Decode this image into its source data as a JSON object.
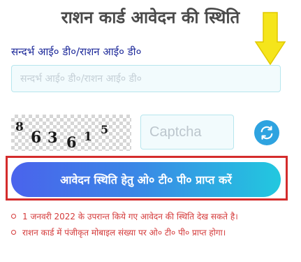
{
  "page": {
    "title": "राशन कार्ड आवेदन की स्थिति"
  },
  "reference": {
    "label": "सन्दर्भ आई० डी०/राशन आई० डी०",
    "value": "",
    "placeholder": "सन्दर्भ आई० डी०/राशन आई० डी०"
  },
  "captcha": {
    "chars": [
      "8",
      "6",
      "3",
      "6",
      "1",
      "5"
    ],
    "input_value": "",
    "input_placeholder": "Captcha",
    "refresh_icon": "refresh-icon"
  },
  "otp_button": {
    "label": "आवेदन स्थिति हेतु ओ० टी० पी० प्राप्त करें"
  },
  "notes": [
    "1 जनवरी 2022 के उपरान्त किये गए आवेदन की स्थिति देख सकते है।",
    "राशन कार्ड में पंजीकृत मोबाइल संख्या पर ओ० टी० पी० प्राप्त होगा।"
  ],
  "colors": {
    "label_blue": "#1e2a9a",
    "note_red": "#d43a3a",
    "highlight_red": "#d42c2c",
    "arrow_yellow": "#f5e51b",
    "button_gradient_start": "#4a63ec",
    "button_gradient_end": "#22c8df",
    "refresh_blue": "#2ea3e0"
  }
}
